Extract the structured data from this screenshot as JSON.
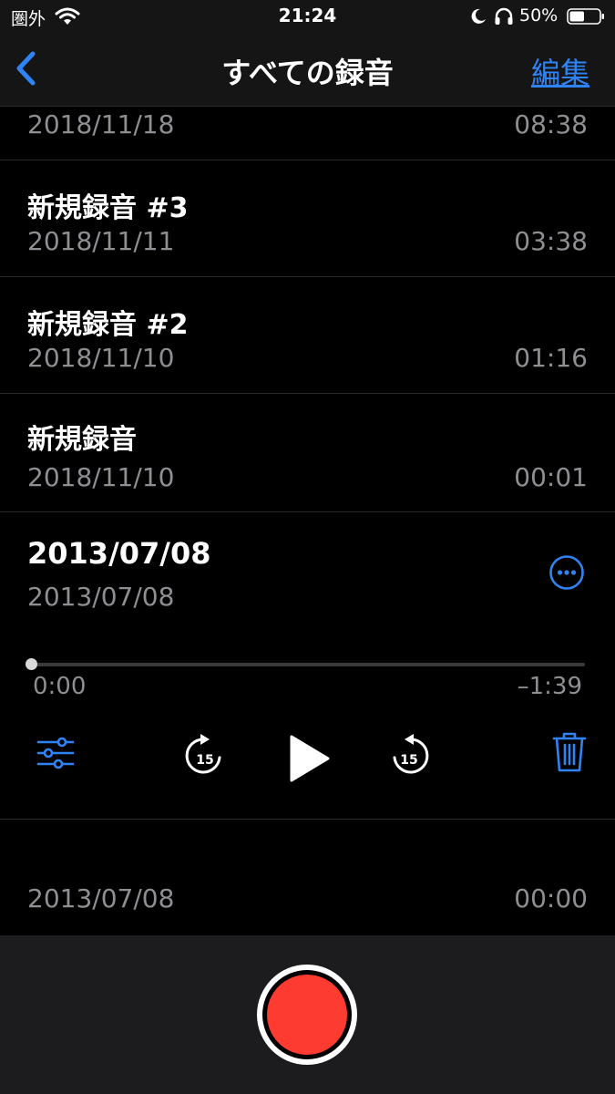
{
  "status_bar": {
    "carrier": "圏外",
    "time": "21:24",
    "battery_percent": "50%",
    "battery_level": 0.5,
    "icons": [
      "wifi-icon",
      "moon-icon",
      "headphones-icon",
      "battery-icon"
    ]
  },
  "nav": {
    "back_icon": "chevron-left-icon",
    "title": "すべての録音",
    "edit_label": "編集"
  },
  "recordings": [
    {
      "title": "",
      "date": "2018/11/18",
      "duration": "08:38"
    },
    {
      "title": "新規録音 #3",
      "date": "2018/11/11",
      "duration": "03:38"
    },
    {
      "title": "新規録音 #2",
      "date": "2018/11/10",
      "duration": "01:16"
    },
    {
      "title": "新規録音",
      "date": "2018/11/10",
      "duration": "00:01"
    }
  ],
  "expanded": {
    "title": "2013/07/08",
    "date": "2013/07/08",
    "elapsed": "0:00",
    "remaining": "–1:39",
    "progress": 0,
    "skip_seconds": "15",
    "icons": [
      "more-icon",
      "equalizer-icon",
      "skip-back-15-icon",
      "play-icon",
      "skip-forward-15-icon",
      "trash-icon"
    ]
  },
  "last_recording": {
    "title": "",
    "date": "2013/07/08",
    "duration": "00:00"
  },
  "colors": {
    "accent": "#2f84f5",
    "record": "#fe3b30",
    "secondary_text": "#8e8e93",
    "background": "#000000",
    "bar": "#1c1c1e"
  }
}
